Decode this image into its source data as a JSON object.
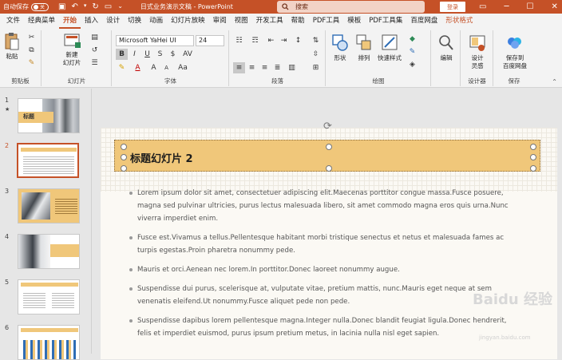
{
  "titlebar": {
    "autosave_label": "自动保存",
    "autosave_state": "关",
    "doc_title": "日式业务演示文稿 - PowerPoint",
    "search_placeholder": "搜索",
    "login_label": "登录",
    "accent_color": "#c55127"
  },
  "tabs": [
    {
      "label": "文件"
    },
    {
      "label": "经典菜单"
    },
    {
      "label": "开始",
      "active": true
    },
    {
      "label": "插入"
    },
    {
      "label": "设计"
    },
    {
      "label": "切换"
    },
    {
      "label": "动画"
    },
    {
      "label": "幻灯片放映"
    },
    {
      "label": "审阅"
    },
    {
      "label": "视图"
    },
    {
      "label": "开发工具"
    },
    {
      "label": "帮助"
    },
    {
      "label": "PDF工具"
    },
    {
      "label": "模板"
    },
    {
      "label": "PDF工具集"
    },
    {
      "label": "百度网盘"
    },
    {
      "label": "形状格式"
    }
  ],
  "ribbon": {
    "clipboard": {
      "paste": "粘贴",
      "label": "剪贴板"
    },
    "slides": {
      "new_slide": "新建",
      "new_slide2": "幻灯片",
      "label": "幻灯片"
    },
    "font": {
      "font_name": "Microsoft YaHei UI",
      "font_size": "24",
      "label": "字体"
    },
    "paragraph": {
      "label": "段落"
    },
    "drawing": {
      "shapes": "形状",
      "arrange": "排列",
      "quick_styles": "快速样式",
      "label": "绘图"
    },
    "editing": {
      "edit": "编辑"
    },
    "designer": {
      "design_ideas": "设计",
      "design_ideas2": "灵感",
      "label": "设计器"
    },
    "save": {
      "save_to": "保存到",
      "save_to2": "百度网盘",
      "label": "保存"
    }
  },
  "thumbnails": [
    {
      "num": "1",
      "star": "★",
      "title": "标题"
    },
    {
      "num": "2",
      "active": true
    },
    {
      "num": "3"
    },
    {
      "num": "4"
    },
    {
      "num": "5"
    },
    {
      "num": "6"
    }
  ],
  "slide": {
    "title": "标题幻灯片 2",
    "bullets": [
      "Lorem ipsum dolor sit amet, consectetuer adipiscing elit.Maecenas porttitor congue massa.Fusce posuere, magna sed pulvinar ultricies, purus lectus malesuada libero, sit amet commodo magna eros quis urna.Nunc viverra imperdiet enim.",
      "Fusce est.Vivamus a tellus.Pellentesque habitant morbi tristique senectus et netus et malesuada fames ac turpis egestas.Proin pharetra nonummy pede.",
      "Mauris et orci.Aenean nec lorem.In porttitor.Donec laoreet nonummy augue.",
      "Suspendisse dui purus, scelerisque at, vulputate vitae, pretium mattis, nunc.Mauris eget neque at sem venenatis eleifend.Ut nonummy.Fusce aliquet pede non pede.",
      "Suspendisse dapibus lorem pellentesque magna.Integer nulla.Donec blandit feugiat ligula.Donec hendrerit, felis et imperdiet euismod, purus ipsum pretium metus, in lacinia nulla nisl eget sapien."
    ],
    "title_fill": "#f0c77a"
  },
  "watermark": {
    "text": "Baidu 经验",
    "url": "jingyan.baidu.com"
  }
}
